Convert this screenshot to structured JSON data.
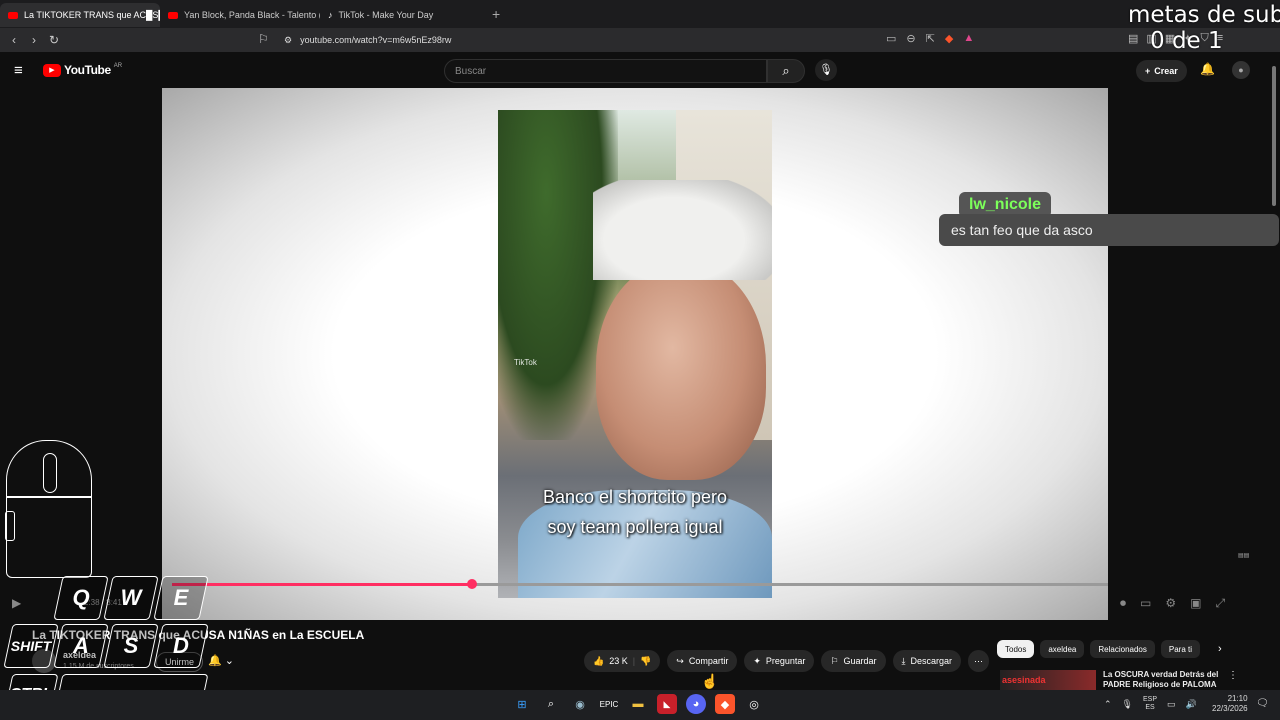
{
  "browser": {
    "tabs": [
      {
        "label": "La TIKTOKER TRANS que AC█S█",
        "active": true
      },
      {
        "label": "Yan Block, Panda Black - Talento (Vid",
        "active": false
      },
      {
        "label": "TikTok - Make Your Day",
        "active": false
      }
    ],
    "url": "youtube.com/watch?v=m6w5nEz98rw"
  },
  "overlay": {
    "line1": "metas de sub",
    "line2": "0 de 1"
  },
  "header": {
    "logo": "YouTube",
    "country": "AR",
    "search_placeholder": "Buscar",
    "create_label": "Crear"
  },
  "video": {
    "subtitle_line1": "Banco el shortcito pero",
    "subtitle_line2": "soy team pollera igual",
    "watermark": "TikTok",
    "chat_user": "lw_nicole",
    "chat_message": "es tan feo que da asco",
    "progress": 0.32,
    "time": "2:38 / 8:41"
  },
  "info": {
    "title": "La TIKTOKER TRANS que ACUSA N1ÑAS en La ESCUELA",
    "channel": "axeldea",
    "subscribers": "1.15 M de suscriptores",
    "join_label": "Unirme"
  },
  "actions": {
    "likes": "23 K",
    "share": "Compartir",
    "ask": "Preguntar",
    "save": "Guardar",
    "download": "Descargar"
  },
  "chips": [
    "Todos",
    "axeldea",
    "Relacionados",
    "Para ti"
  ],
  "recommendation": {
    "thumb_text": "asesinada",
    "title": "La OSCURA verdad Detrás del PADRE Religioso de PALOMA"
  },
  "keys": {
    "q": "Q",
    "w": "W",
    "e": "E",
    "shift": "SHIFT",
    "a": "A",
    "s": "S",
    "d": "D",
    "ctrl": "CTRL"
  },
  "taskbar": {
    "lang1": "ESP",
    "lang2": "ES",
    "time": "21:10",
    "date": "22/3/2026"
  }
}
